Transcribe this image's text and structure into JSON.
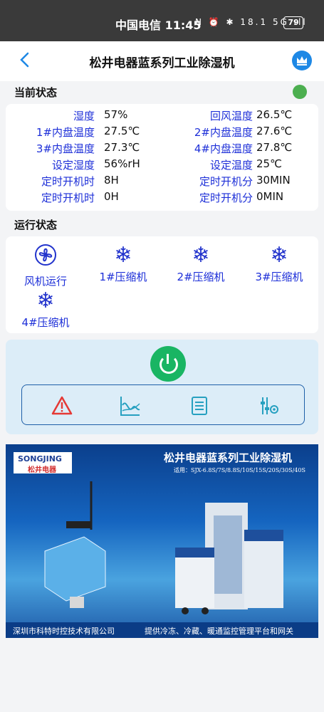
{
  "statusbar": {
    "carrier_time": "中国电信 11:45",
    "icons_text": "N ⏰ ✱ 18.1 5G ıll",
    "battery": "79"
  },
  "header": {
    "title": "松井电器蓝系列工业除湿机"
  },
  "current_status": {
    "label": "当前状态",
    "status_color": "#4caf50",
    "rows": [
      {
        "l1": "湿度",
        "v1": "57%",
        "l2": "回风温度",
        "v2": "26.5℃"
      },
      {
        "l1": "1#内盘温度",
        "v1": "27.5℃",
        "l2": "2#内盘温度",
        "v2": "27.6℃"
      },
      {
        "l1": "3#内盘温度",
        "v1": "27.3℃",
        "l2": "4#内盘温度",
        "v2": "27.8℃"
      },
      {
        "l1": "设定湿度",
        "v1": "56%rH",
        "l2": "设定温度",
        "v2": "25℃"
      },
      {
        "l1": "定时开机时",
        "v1": "8H",
        "l2": "定时开机分",
        "v2": "30MIN"
      },
      {
        "l1": "定时开机时",
        "v1": "0H",
        "l2": "定时开机分",
        "v2": "0MIN"
      }
    ]
  },
  "run_status": {
    "label": "运行状态",
    "items": [
      "风机运行",
      "1#压缩机",
      "2#压缩机",
      "3#压缩机",
      "4#压缩机"
    ]
  },
  "banner": {
    "logo_en": "SONGJING",
    "logo_cn": "松井电器",
    "title": "松井电器蓝系列工业除湿机",
    "subtitle": "适用：SJX-6.8S/7S/8.8S/10S/15S/20S/30S/40S",
    "footer_left": "深圳市科特时控技术有限公司",
    "footer_right": "提供冷冻、冷藏、暖通监控管理平台和网关"
  }
}
